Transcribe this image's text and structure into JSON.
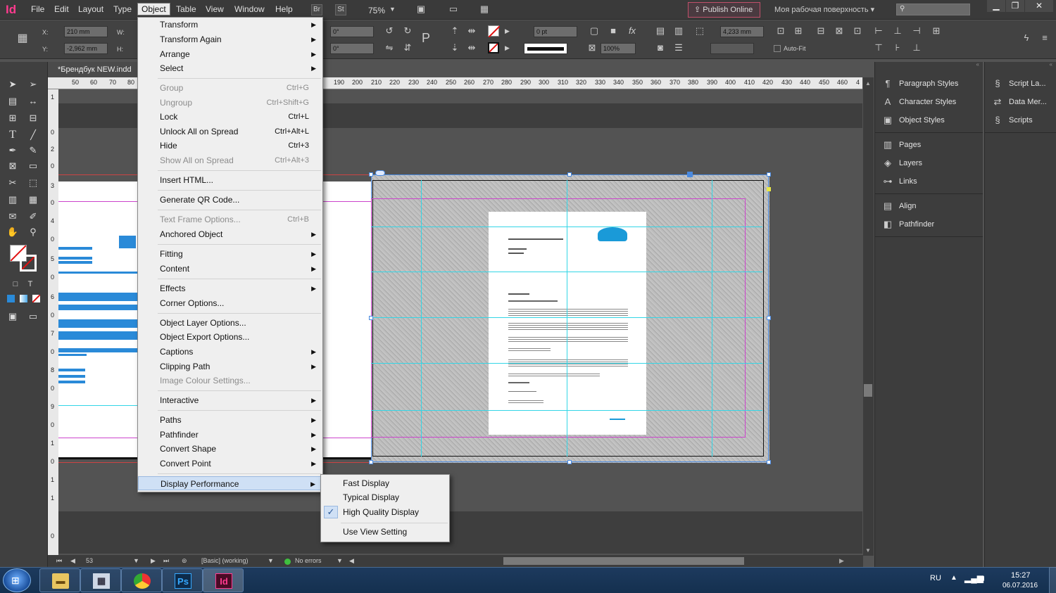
{
  "app": {
    "logo": "Id"
  },
  "menubar": {
    "items": [
      "File",
      "Edit",
      "Layout",
      "Type",
      "Object",
      "Table",
      "View",
      "Window",
      "Help"
    ],
    "active": "Object",
    "bridge_label": "Br",
    "stock_label": "St",
    "zoom": "75%",
    "publish_label": "Publish Online",
    "workspace_label": "Моя рабочая поверхность"
  },
  "control": {
    "x_label": "X:",
    "x_value": "210 mm",
    "y_label": "Y:",
    "y_value": "-2,962 mm",
    "w_label": "W:",
    "h_label": "H:",
    "rotate_value": "0°",
    "shear_value": "0°",
    "stroke_value": "0 pt",
    "opacity_value": "100%",
    "fit_value": "4,233 mm",
    "autofit_label": "Auto-Fit"
  },
  "document": {
    "tab_title": "*Брендбук NEW.indd"
  },
  "rulers": {
    "h_ticks": [
      "50",
      "60",
      "70",
      "80",
      "190",
      "200",
      "210",
      "220",
      "230",
      "240",
      "250",
      "260",
      "270",
      "280",
      "290",
      "300",
      "310",
      "320",
      "330",
      "340",
      "350",
      "360",
      "370",
      "380",
      "390",
      "400",
      "410",
      "420",
      "430",
      "440",
      "450",
      "460",
      "4"
    ],
    "v_ticks": [
      "1",
      "0",
      "2",
      "0",
      "3",
      "0",
      "4",
      "0",
      "5",
      "0",
      "6",
      "0",
      "7",
      "0",
      "8",
      "0",
      "9",
      "0",
      "1",
      "0",
      "1",
      "1",
      "0"
    ]
  },
  "object_menu": {
    "items": [
      {
        "label": "Transform",
        "shortcut": "",
        "arrow": true,
        "disabled": false
      },
      {
        "label": "Transform Again",
        "shortcut": "",
        "arrow": true,
        "disabled": false
      },
      {
        "label": "Arrange",
        "shortcut": "",
        "arrow": true,
        "disabled": false
      },
      {
        "label": "Select",
        "shortcut": "",
        "arrow": true,
        "disabled": false
      },
      {
        "label": "Group",
        "shortcut": "Ctrl+G",
        "arrow": false,
        "disabled": true
      },
      {
        "label": "Ungroup",
        "shortcut": "Ctrl+Shift+G",
        "arrow": false,
        "disabled": true
      },
      {
        "label": "Lock",
        "shortcut": "Ctrl+L",
        "arrow": false,
        "disabled": false
      },
      {
        "label": "Unlock All on Spread",
        "shortcut": "Ctrl+Alt+L",
        "arrow": false,
        "disabled": false
      },
      {
        "label": "Hide",
        "shortcut": "Ctrl+3",
        "arrow": false,
        "disabled": false
      },
      {
        "label": "Show All on Spread",
        "shortcut": "Ctrl+Alt+3",
        "arrow": false,
        "disabled": true
      },
      {
        "label": "Insert HTML...",
        "shortcut": "",
        "arrow": false,
        "disabled": false
      },
      {
        "label": "Generate QR Code...",
        "shortcut": "",
        "arrow": false,
        "disabled": false
      },
      {
        "label": "Text Frame Options...",
        "shortcut": "Ctrl+B",
        "arrow": false,
        "disabled": true
      },
      {
        "label": "Anchored Object",
        "shortcut": "",
        "arrow": true,
        "disabled": false
      },
      {
        "label": "Fitting",
        "shortcut": "",
        "arrow": true,
        "disabled": false
      },
      {
        "label": "Content",
        "shortcut": "",
        "arrow": true,
        "disabled": false
      },
      {
        "label": "Effects",
        "shortcut": "",
        "arrow": true,
        "disabled": false
      },
      {
        "label": "Corner Options...",
        "shortcut": "",
        "arrow": false,
        "disabled": false
      },
      {
        "label": "Object Layer Options...",
        "shortcut": "",
        "arrow": false,
        "disabled": false
      },
      {
        "label": "Object Export Options...",
        "shortcut": "",
        "arrow": false,
        "disabled": false
      },
      {
        "label": "Captions",
        "shortcut": "",
        "arrow": true,
        "disabled": false
      },
      {
        "label": "Clipping Path",
        "shortcut": "",
        "arrow": true,
        "disabled": false
      },
      {
        "label": "Image Colour Settings...",
        "shortcut": "",
        "arrow": false,
        "disabled": true
      },
      {
        "label": "Interactive",
        "shortcut": "",
        "arrow": true,
        "disabled": false
      },
      {
        "label": "Paths",
        "shortcut": "",
        "arrow": true,
        "disabled": false
      },
      {
        "label": "Pathfinder",
        "shortcut": "",
        "arrow": true,
        "disabled": false
      },
      {
        "label": "Convert Shape",
        "shortcut": "",
        "arrow": true,
        "disabled": false
      },
      {
        "label": "Convert Point",
        "shortcut": "",
        "arrow": true,
        "disabled": false
      },
      {
        "label": "Display Performance",
        "shortcut": "",
        "arrow": true,
        "disabled": false
      }
    ]
  },
  "display_submenu": {
    "items": [
      "Fast Display",
      "Typical Display",
      "High Quality Display",
      "Use View Setting"
    ],
    "checked": "High Quality Display"
  },
  "panels_left": {
    "groups": [
      [
        "Paragraph Styles",
        "Character Styles",
        "Object Styles"
      ],
      [
        "Pages",
        "Layers",
        "Links"
      ],
      [
        "Align",
        "Pathfinder"
      ]
    ]
  },
  "panels_right": {
    "items": [
      "Script La...",
      "Data Mer...",
      "Scripts"
    ]
  },
  "status": {
    "page": "53",
    "preflight_profile": "[Basic] (working)",
    "errors": "No errors"
  },
  "taskbar": {
    "language": "RU",
    "time": "15:27",
    "date": "06.07.2016",
    "ps_label": "Ps",
    "id_label": "Id"
  },
  "colors": {
    "accent": "#ff3b8f",
    "guide_cyan": "#33d6e6",
    "margin_magenta": "#cc44cc",
    "menu_highlight": "#cfe0f5"
  }
}
